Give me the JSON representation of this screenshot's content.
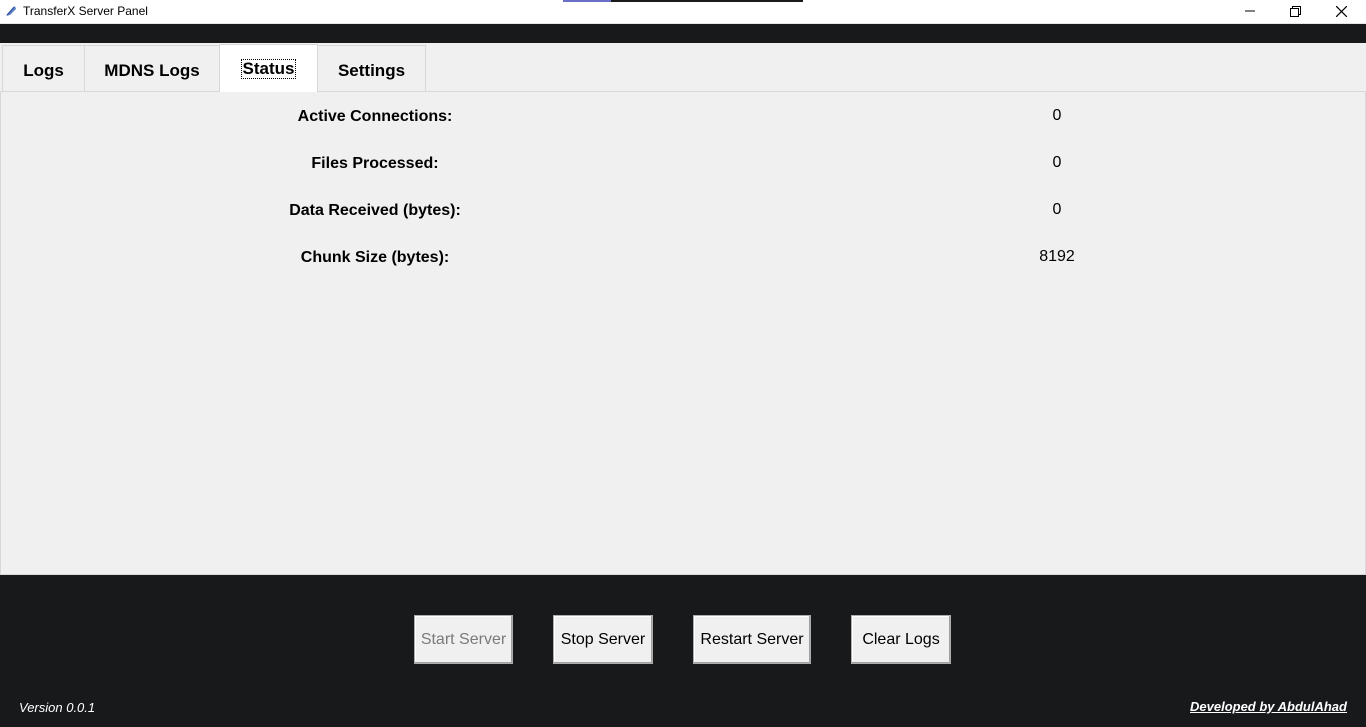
{
  "window": {
    "title": "TransferX Server Panel",
    "progress_fraction": 0.2
  },
  "tabs": [
    {
      "label": "Logs",
      "active": false
    },
    {
      "label": "MDNS Logs",
      "active": false
    },
    {
      "label": "Status",
      "active": true
    },
    {
      "label": "Settings",
      "active": false
    }
  ],
  "status": {
    "rows": [
      {
        "label": "Active Connections:",
        "value": "0"
      },
      {
        "label": "Files Processed:",
        "value": "0"
      },
      {
        "label": "Data Received (bytes):",
        "value": "0"
      },
      {
        "label": "Chunk Size (bytes):",
        "value": "8192"
      }
    ]
  },
  "buttons": {
    "start": {
      "label": "Start Server",
      "enabled": false
    },
    "stop": {
      "label": "Stop Server",
      "enabled": true
    },
    "restart": {
      "label": "Restart Server",
      "enabled": true
    },
    "clear": {
      "label": "Clear Logs",
      "enabled": true
    }
  },
  "footer": {
    "version": "Version 0.0.1",
    "credit": "Developed by AbdulAhad"
  },
  "icons": {
    "app": "app-feather-icon",
    "minimize": "minimize-icon",
    "maximize": "restore-icon",
    "close": "close-icon"
  },
  "colors": {
    "background_dark": "#18191b",
    "panel": "#f0f0f0",
    "progress_accent": "#6a6ec4"
  }
}
